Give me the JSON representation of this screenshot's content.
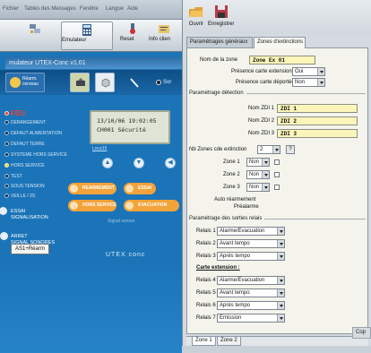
{
  "left_app": {
    "menu": [
      "Fichier",
      "Tables des Messages",
      "Fenêtre",
      "Langue",
      "Aide"
    ],
    "toolbar": {
      "config_label": "",
      "emul_label": "Emulateur",
      "reset_label": "Reset",
      "info_label": "Info clien"
    },
    "window_title": "mulateur UTEX-Conc v1.01",
    "toolstrip": {
      "home_label": "Réarm. cerveau",
      "so_label": "Sor"
    },
    "statuses": [
      "FEU",
      "DERANGEMENT",
      "DEFAUT ALIMENTATION",
      "DEFAUT TERRE",
      "SYSTEME HORS SERVICE",
      "HORS SERVICE",
      "TEST",
      "SOUS TENSION",
      "VEILLE / 2S"
    ],
    "lcd": {
      "line1": "13/10/06 19:02:05",
      "line2": "CH001 Sécurité",
      "link": "Loca15"
    },
    "nav_buttons": [
      "▲",
      "▼",
      "◀"
    ],
    "actions": {
      "rearm": "REARMEMENT",
      "essai": "ESSAI",
      "hors": "HORS SERVICE",
      "evac": "EVACUATION"
    },
    "essai_label": "ESSAI\nSIGNALISATION",
    "arret_label": "ARRET\nSIGNAL SONORES",
    "signal_label": "Signal sonore",
    "asi_button": "AS1+Réarm",
    "brand": "UTEX conc"
  },
  "right_app": {
    "toolbar": {
      "open_label": "Ouvrir",
      "save_label": "Enregistrer"
    },
    "tabs": [
      "Paramétrages généraux",
      "Zones d'extinctions"
    ],
    "zone_name_label": "Nom de la zone",
    "zone_name_value": "Zone Ex 01",
    "presence_ext_label": "Présence carte extension",
    "presence_ext_value": "Oui",
    "presence_dep_label": "Présence carte déportée",
    "presence_dep_value": "Non",
    "detection_group": "Paramétrage détection",
    "zdi": [
      {
        "label": "Nom ZDI 1",
        "value": "ZDI 1"
      },
      {
        "label": "Nom ZDI 2",
        "value": "ZDI 2"
      },
      {
        "label": "Nom ZDI 3",
        "value": "ZDI 3"
      }
    ],
    "nb_zones_label": "Nb Zones cde extinction",
    "nb_zones_value": "2",
    "zones": [
      {
        "label": "Zone 1",
        "value": "Non"
      },
      {
        "label": "Zone 2",
        "value": "Non"
      },
      {
        "label": "Zone 3",
        "value": "Non"
      }
    ],
    "auto_rearm_label": "Auto réarmement",
    "prealarme_label": "Préalarme",
    "relais_group": "Paramétrage des sorties relais",
    "relais": [
      {
        "label": "Relais 1",
        "value": "Alarme/Evacuation"
      },
      {
        "label": "Relais 2",
        "value": "Avant tempo"
      },
      {
        "label": "Relais 3",
        "value": "Après tempo"
      }
    ],
    "carte_ext_label": "Carte extension :",
    "relais_ext": [
      {
        "label": "Relais 4",
        "value": "Alarme/Evacuation"
      },
      {
        "label": "Relais 5",
        "value": "Avant tempo"
      },
      {
        "label": "Relais 6",
        "value": "Après tempo"
      },
      {
        "label": "Relais 7",
        "value": "Emission"
      }
    ],
    "bottom_tabs": [
      "Zone 1",
      "Zone 2"
    ],
    "copy_label": "Cop"
  }
}
